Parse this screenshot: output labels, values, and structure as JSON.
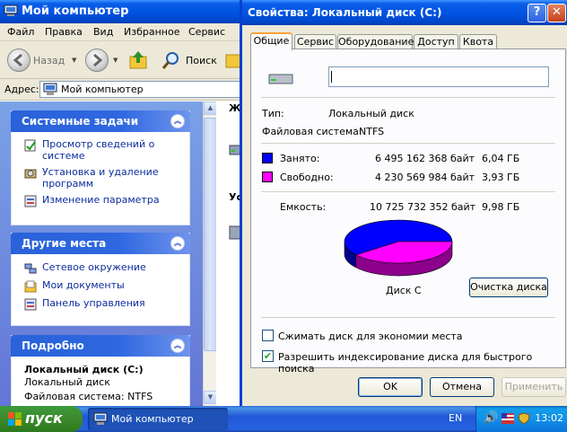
{
  "explorer": {
    "title": "Мой компьютер",
    "menu": [
      "Файл",
      "Правка",
      "Вид",
      "Избранное",
      "Сервис"
    ],
    "toolbar": {
      "back_label": "Назад",
      "search_label": "Поиск"
    },
    "address": {
      "label": "Адрес:",
      "value": "Мой компьютер"
    },
    "system_tasks": {
      "title": "Системные задачи",
      "items": [
        "Просмотр сведений о системе",
        "Установка и удаление программ",
        "Изменение параметра"
      ]
    },
    "other_places": {
      "title": "Другие места",
      "items": [
        "Сетевое окружение",
        "Мои документы",
        "Панель управления"
      ]
    },
    "details": {
      "title": "Подробно",
      "name": "Локальный диск (C:)",
      "type": "Локальный диск",
      "fs": "Файловая система: NTFS"
    },
    "right_partial": [
      "Ж",
      "Ус"
    ]
  },
  "dialog": {
    "title": "Свойства: Локальный диск (C:)",
    "help_glyph": "?",
    "close_glyph": "✕",
    "tabs": [
      "Общие",
      "Сервис",
      "Оборудование",
      "Доступ",
      "Квота"
    ],
    "active_tab": 0,
    "volume_label_value": "",
    "type_label": "Тип:",
    "type_value": "Локальный диск",
    "fs_label": "Файловая система:",
    "fs_value": "NTFS",
    "used": {
      "label": "Занято:",
      "bytes": "6 495 162 368 байт",
      "size": "6,04 ГБ",
      "color": "#0000ff"
    },
    "free": {
      "label": "Свободно:",
      "bytes": "4 230 569 984 байт",
      "size": "3,93 ГБ",
      "color": "#ff00ff"
    },
    "capacity": {
      "label": "Емкость:",
      "bytes": "10 725 732 352 байт",
      "size": "9,98 ГБ"
    },
    "disk_name": "Диск C",
    "cleanup_button": "Очистка диска",
    "compress_label": "Сжимать диск для экономии места",
    "compress_checked": false,
    "index_label": "Разрешить индексирование диска для быстрого поиска",
    "index_checked": true,
    "check_glyph": "✔",
    "ok": "OK",
    "cancel": "Отмена",
    "apply": "Применить"
  },
  "taskbar": {
    "start_label": "пуск",
    "task_label": "Мой компьютер",
    "lang": "EN",
    "clock": "13:02"
  },
  "chart_data": {
    "type": "pie",
    "categories": [
      "Занято",
      "Свободно"
    ],
    "values": [
      6495162368,
      4230569984
    ],
    "colors": [
      "#0000ff",
      "#ff00ff"
    ]
  }
}
